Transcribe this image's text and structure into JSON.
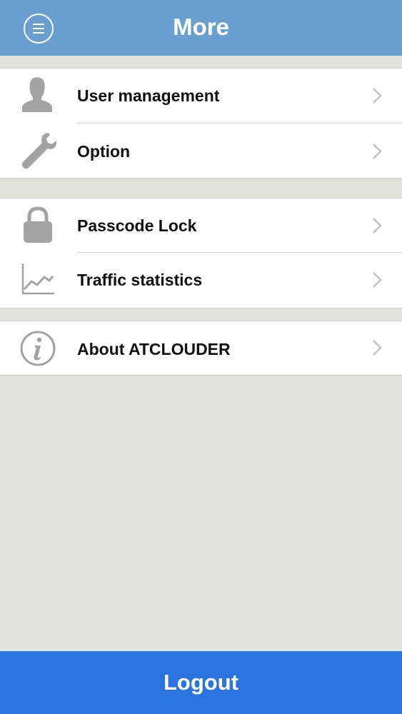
{
  "header": {
    "title": "More",
    "menu_icon": "hamburger-circle-icon",
    "bg_color": "#6aa0d0"
  },
  "groups": [
    {
      "items": [
        {
          "label": "User management",
          "icon": "user-silhouette-icon"
        },
        {
          "label": "Option",
          "icon": "wrench-icon"
        }
      ]
    },
    {
      "items": [
        {
          "label": "Passcode Lock",
          "icon": "padlock-icon"
        },
        {
          "label": "Traffic statistics",
          "icon": "line-chart-icon"
        }
      ]
    },
    {
      "items": [
        {
          "label": "About ATCLOUDER",
          "icon": "info-circle-icon"
        }
      ]
    }
  ],
  "footer": {
    "logout_label": "Logout",
    "bg_color": "#2a74df"
  }
}
